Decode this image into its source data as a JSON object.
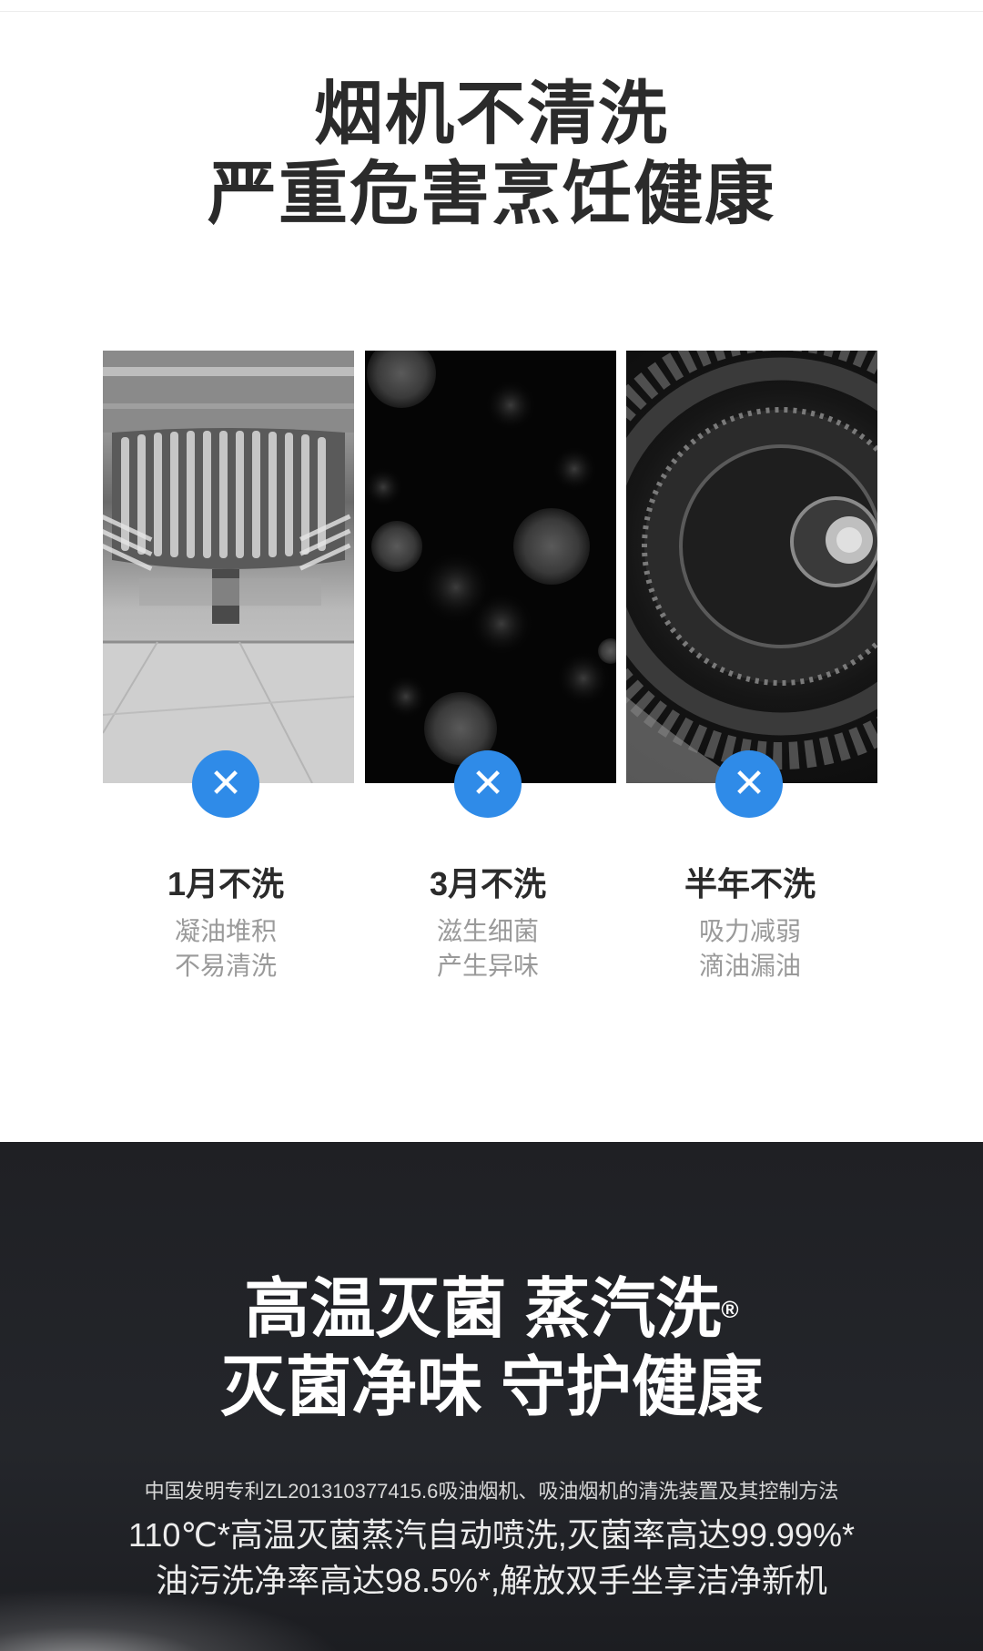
{
  "headline": {
    "line1": "烟机不清洗",
    "line2": "严重危害烹饪健康"
  },
  "cards": [
    {
      "title": "1月不洗",
      "desc1": "凝油堆积",
      "desc2": "不易清洗",
      "badge_icon": "close-icon"
    },
    {
      "title": "3月不洗",
      "desc1": "滋生细菌",
      "desc2": "产生异味",
      "badge_icon": "close-icon"
    },
    {
      "title": "半年不洗",
      "desc1": "吸力减弱",
      "desc2": "滴油漏油",
      "badge_icon": "close-icon"
    }
  ],
  "badge_symbol": "✕",
  "feature": {
    "title1": "高温灭菌 蒸汽洗",
    "registered": "®",
    "title2": "灭菌净味  守护健康",
    "patent": "中国发明专利ZL201310377415.6吸油烟机、吸油烟机的清洗装置及其控制方法",
    "line1": "110℃*高温灭菌蒸汽自动喷洗,灭菌率高达99.99%*",
    "line2": "油污洗净率高达98.5%*,解放双手坐享洁净新机"
  },
  "colors": {
    "accent_blue": "#2f8be8",
    "dark_bg": "#222327",
    "heading": "#2b2b2b",
    "muted": "#9a9a9a"
  }
}
